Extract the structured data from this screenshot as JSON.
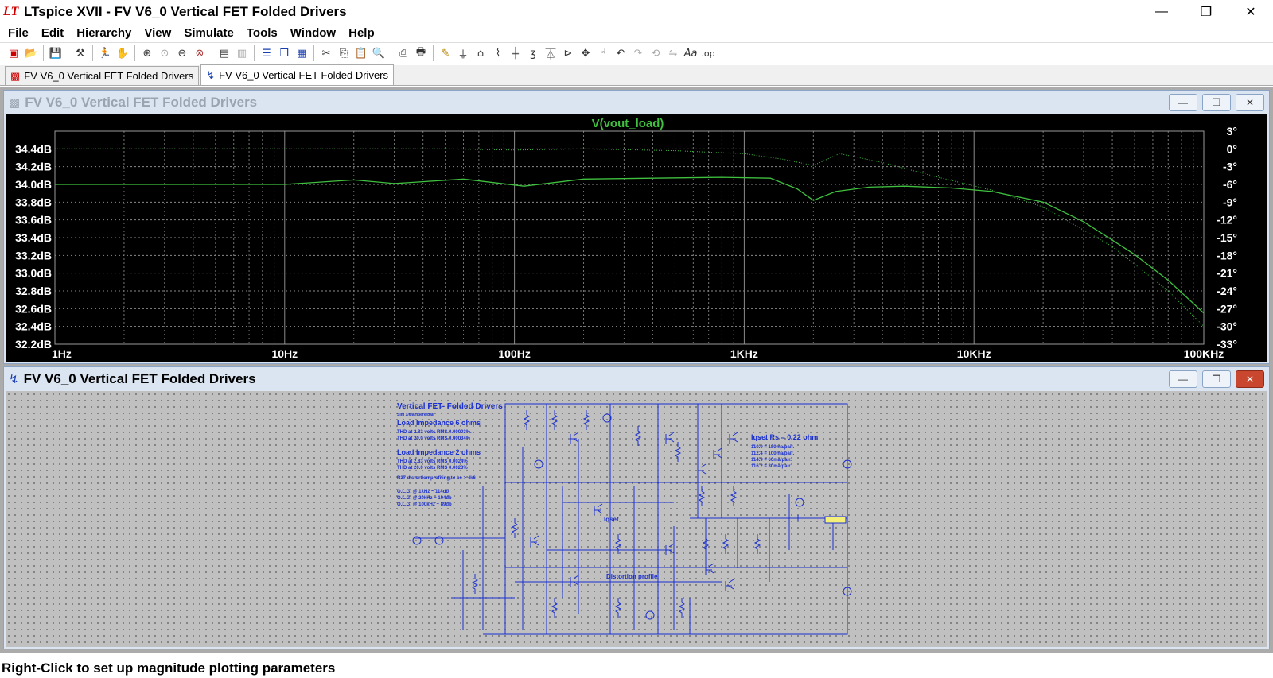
{
  "app": {
    "title": "LTspice XVII - FV V6_0 Vertical FET Folded Drivers",
    "logo_text": "LT"
  },
  "window_controls": {
    "minimize": "—",
    "maximize": "❐",
    "close": "✕"
  },
  "menu": [
    "File",
    "Edit",
    "Hierarchy",
    "View",
    "Simulate",
    "Tools",
    "Window",
    "Help"
  ],
  "tabs": [
    {
      "label": "FV V6_0 Vertical FET Folded Drivers",
      "icon": "waveform-icon",
      "active": false
    },
    {
      "label": "FV V6_0 Vertical FET Folded Drivers",
      "icon": "schematic-icon",
      "active": true
    }
  ],
  "waveform_window": {
    "title": "FV V6_0 Vertical FET Folded Drivers",
    "trace_label": "V(vout_load)"
  },
  "schematic_window": {
    "title": "FV V6_0 Vertical FET Folded Drivers",
    "notes": {
      "heading": "Vertical FET- Folded Drivers",
      "sub": "Sim 1/6/ampere/pair",
      "load6_title": "Load Impedance 6 ohms",
      "load6_line1": "THD at 2.83 volts RMS 0.00003%.",
      "load6_line2": "THD at 20.0 volts RMS 0.00034%",
      "load2_title": "Load Impedance 2 ohms",
      "load2_line1": "THD at 2.83 volts RMS 0.0024%",
      "load2_line2": "THD at 20.0 volts RMS 0.0023%",
      "r37": "R37 distortion profiling,to be > 4k6",
      "olg1": "O.L.G. @    1kHz ~ 114db",
      "olg2": "O.L.G. @  20kHz ~ 104db",
      "olg3": "O.L.G. @ 100kHz ~  89db",
      "iqset_title": "Iqset Rs = 0.22 ohm",
      "iq1": "110.0 = 180ma/pair.",
      "iq2": "112.4 = 100ma/pair.",
      "iq3": "114.9 =   60ma/pair.",
      "iq4": "116.2 =   30ma/pair.",
      "iqset_label": "Iqset",
      "distortion_label": "Distortion profile"
    }
  },
  "status": {
    "text": "Right-Click to set up magnitude plotting parameters"
  },
  "chart_data": {
    "type": "line",
    "title": "V(vout_load)",
    "x_scale": "log",
    "xlim": [
      1,
      100000
    ],
    "x_tick_labels": [
      "1Hz",
      "10Hz",
      "100Hz",
      "1KHz",
      "10KHz",
      "100KHz"
    ],
    "x_ticks": [
      1,
      10,
      100,
      1000,
      10000,
      100000
    ],
    "ylim": [
      32.2,
      34.6
    ],
    "y_tick_labels": [
      "34.4dB",
      "34.2dB",
      "34.0dB",
      "33.8dB",
      "33.6dB",
      "33.4dB",
      "33.2dB",
      "33.0dB",
      "32.8dB",
      "32.6dB",
      "32.4dB",
      "32.2dB"
    ],
    "y_ticks": [
      34.4,
      34.2,
      34.0,
      33.8,
      33.6,
      33.4,
      33.2,
      33.0,
      32.8,
      32.6,
      32.4,
      32.2
    ],
    "y2lim": [
      -33,
      3
    ],
    "y2_tick_labels": [
      "3°",
      "0°",
      "-3°",
      "-6°",
      "-9°",
      "-12°",
      "-15°",
      "-18°",
      "-21°",
      "-24°",
      "-27°",
      "-30°",
      "-33°"
    ],
    "y2_ticks": [
      3,
      0,
      -3,
      -6,
      -9,
      -12,
      -15,
      -18,
      -21,
      -24,
      -27,
      -30,
      -33
    ],
    "grid": true,
    "trace_color": "#3fc03f",
    "background": "#000000",
    "series": [
      {
        "axis": "magnitude",
        "style": "solid",
        "x": [
          1,
          3,
          10,
          20,
          30,
          60,
          110,
          200,
          400,
          800,
          1300,
          1700,
          2000,
          2500,
          3500,
          5000,
          8000,
          12000,
          20000,
          30000,
          50000,
          70000,
          100000
        ],
        "y": [
          34.0,
          34.0,
          34.0,
          34.05,
          34.01,
          34.06,
          33.98,
          34.06,
          34.07,
          34.08,
          34.07,
          33.95,
          33.82,
          33.92,
          33.97,
          33.98,
          33.96,
          33.92,
          33.8,
          33.58,
          33.21,
          32.92,
          32.55
        ]
      },
      {
        "axis": "phase",
        "style": "dotted",
        "x": [
          1,
          10,
          50,
          100,
          200,
          500,
          1000,
          1500,
          2000,
          2600,
          4000,
          7000,
          12000,
          20000,
          40000,
          70000,
          100000
        ],
        "y": [
          0,
          0,
          0,
          -0.2,
          0,
          -0.3,
          -0.8,
          -1.8,
          -2.8,
          -0.8,
          -2.3,
          -4.8,
          -7.0,
          -9.8,
          -16.5,
          -24.0,
          -30.0
        ]
      }
    ]
  }
}
